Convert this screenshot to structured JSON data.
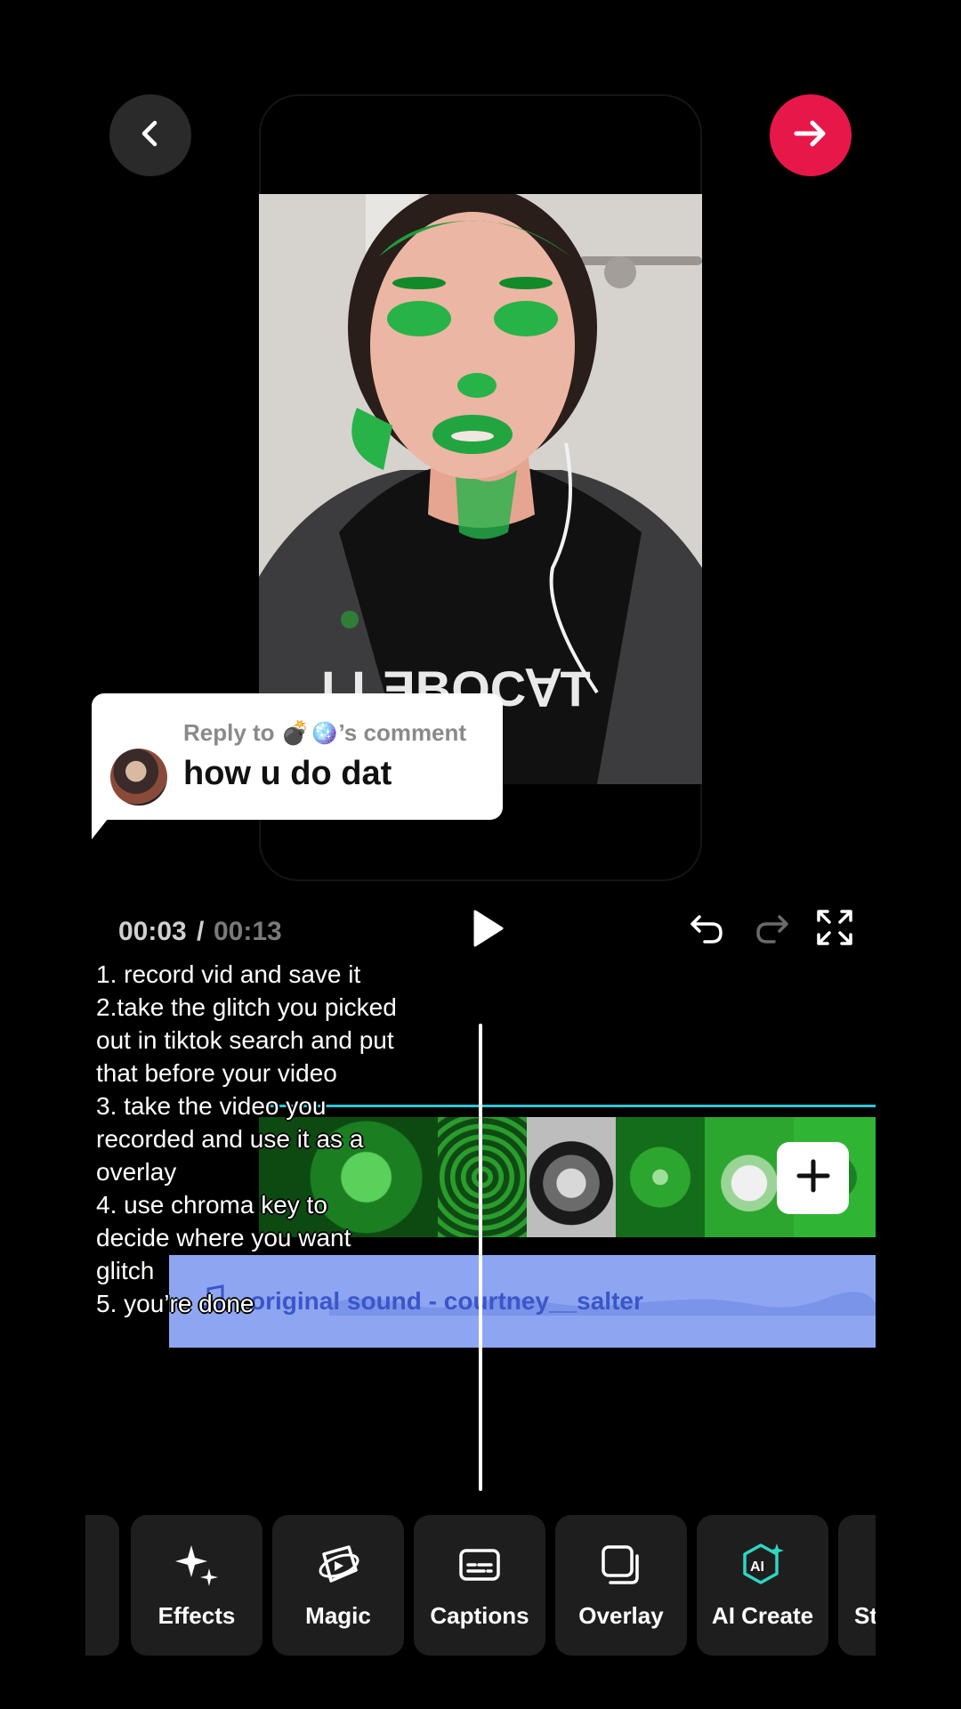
{
  "header": {
    "back_icon": "chevron-left-icon",
    "next_icon": "arrow-right-icon",
    "accent": "#e8174a"
  },
  "reply": {
    "reply_to": "Reply to 💣🪩’s comment",
    "comment": "how u do dat"
  },
  "playback": {
    "current_time": "00:03",
    "separator": "/",
    "total_time": "00:13",
    "play_icon": "play-icon",
    "undo_icon": "undo-icon",
    "redo_icon": "redo-icon",
    "fullscreen_icon": "fullscreen-icon"
  },
  "overlay_text": "1. record vid and save it\n2.take the glitch you picked out in tiktok search and put that before your video\n3. take the video you recorded and use it as a overlay\n4. use chroma key to decide where you want glitch\n5. you’re done",
  "timeline": {
    "audio_label": "original sound - courtney__salter",
    "audio_icon": "music-note-icon",
    "add_icon": "plus-icon",
    "audio_color": "#8ea6f2",
    "video_accent": "#2ec4d6"
  },
  "toolbar": {
    "items": [
      {
        "label": "",
        "icon": "partial-tool"
      },
      {
        "label": "Effects",
        "icon": "sparkles-icon"
      },
      {
        "label": "Magic",
        "icon": "magic-icon"
      },
      {
        "label": "Captions",
        "icon": "captions-icon"
      },
      {
        "label": "Overlay",
        "icon": "overlay-icon"
      },
      {
        "label": "AI Create",
        "icon": "ai-create-icon"
      },
      {
        "label": "St",
        "icon": "partial-tool"
      }
    ]
  }
}
